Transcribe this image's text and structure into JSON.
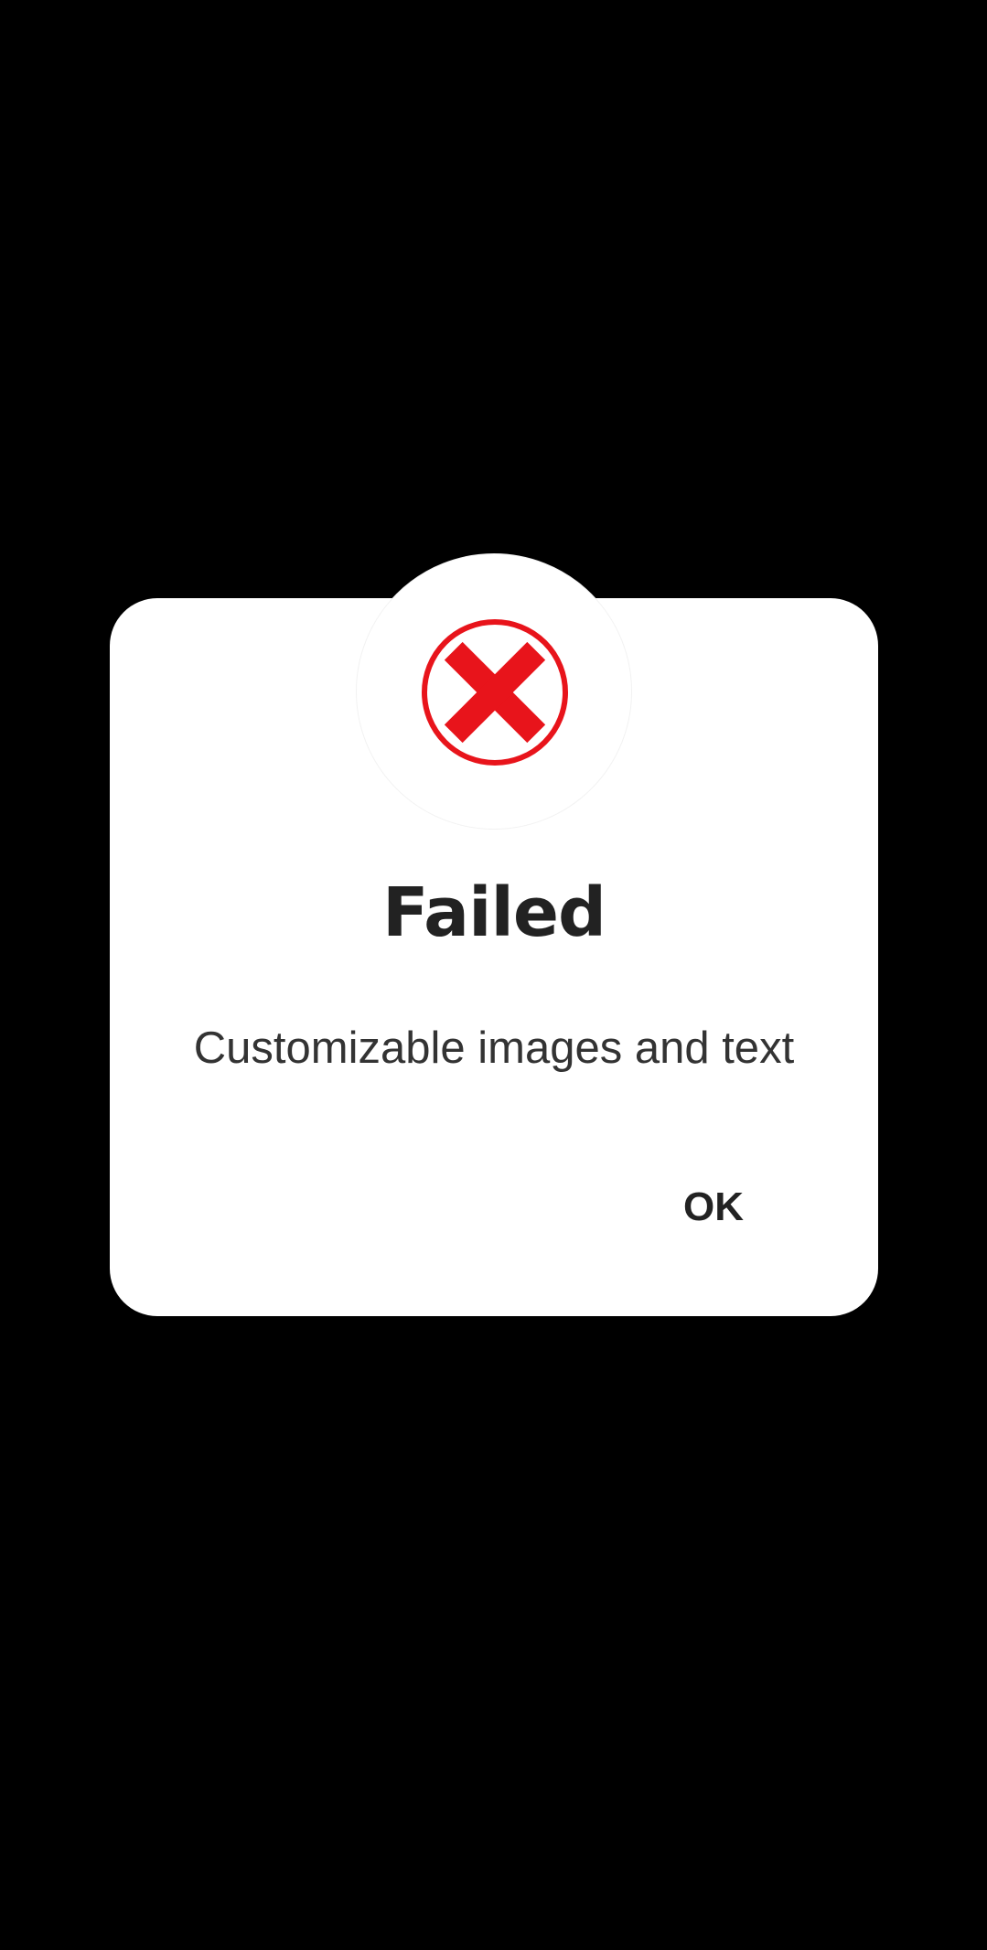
{
  "dialog": {
    "icon": "error-x-icon",
    "icon_color": "#e8141b",
    "title": "Failed",
    "message": "Customizable images and text",
    "ok_label": "OK"
  },
  "colors": {
    "background": "#000000",
    "dialog_background": "#ffffff",
    "text": "#222222"
  }
}
